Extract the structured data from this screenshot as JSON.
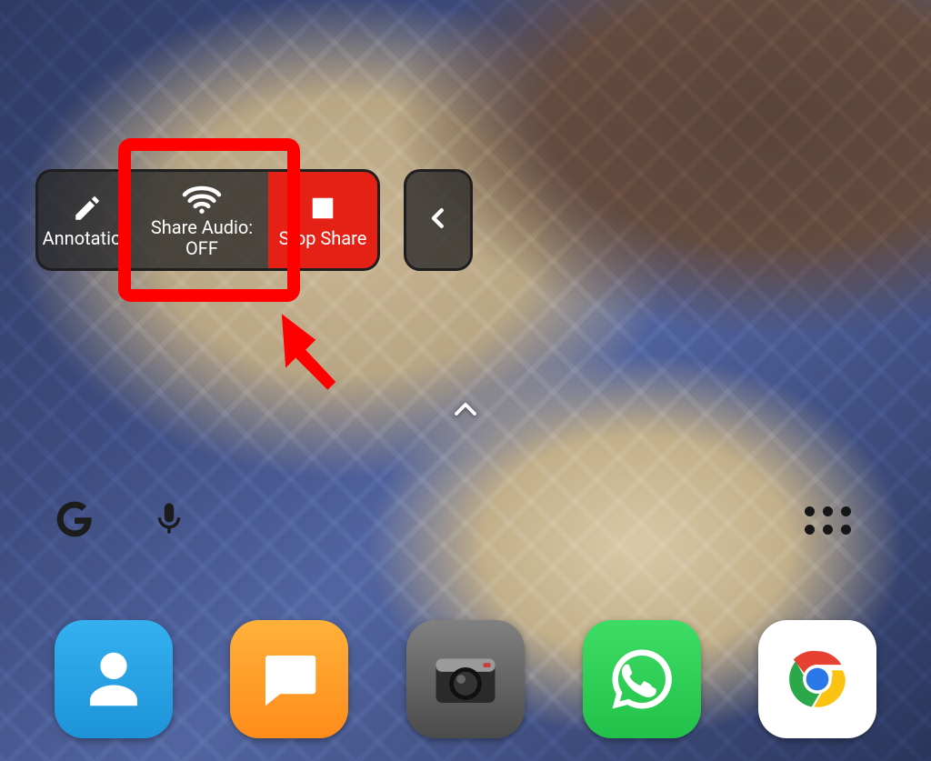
{
  "toolbar": {
    "annotation_label": "Annotation",
    "share_audio_label": "Share Audio:\nOFF",
    "stop_share_label": "Stop Share"
  },
  "dock": {
    "contacts": "Contacts",
    "messages": "Messages",
    "camera": "Camera",
    "whatsapp": "WhatsApp",
    "chrome": "Chrome"
  },
  "search": {
    "google": "Google",
    "voice": "Voice Search",
    "apps": "Apps"
  },
  "colors": {
    "highlight": "#ff0000",
    "stop_bg": "#e52116",
    "toolbar_bg": "rgba(40,40,40,0.78)"
  }
}
